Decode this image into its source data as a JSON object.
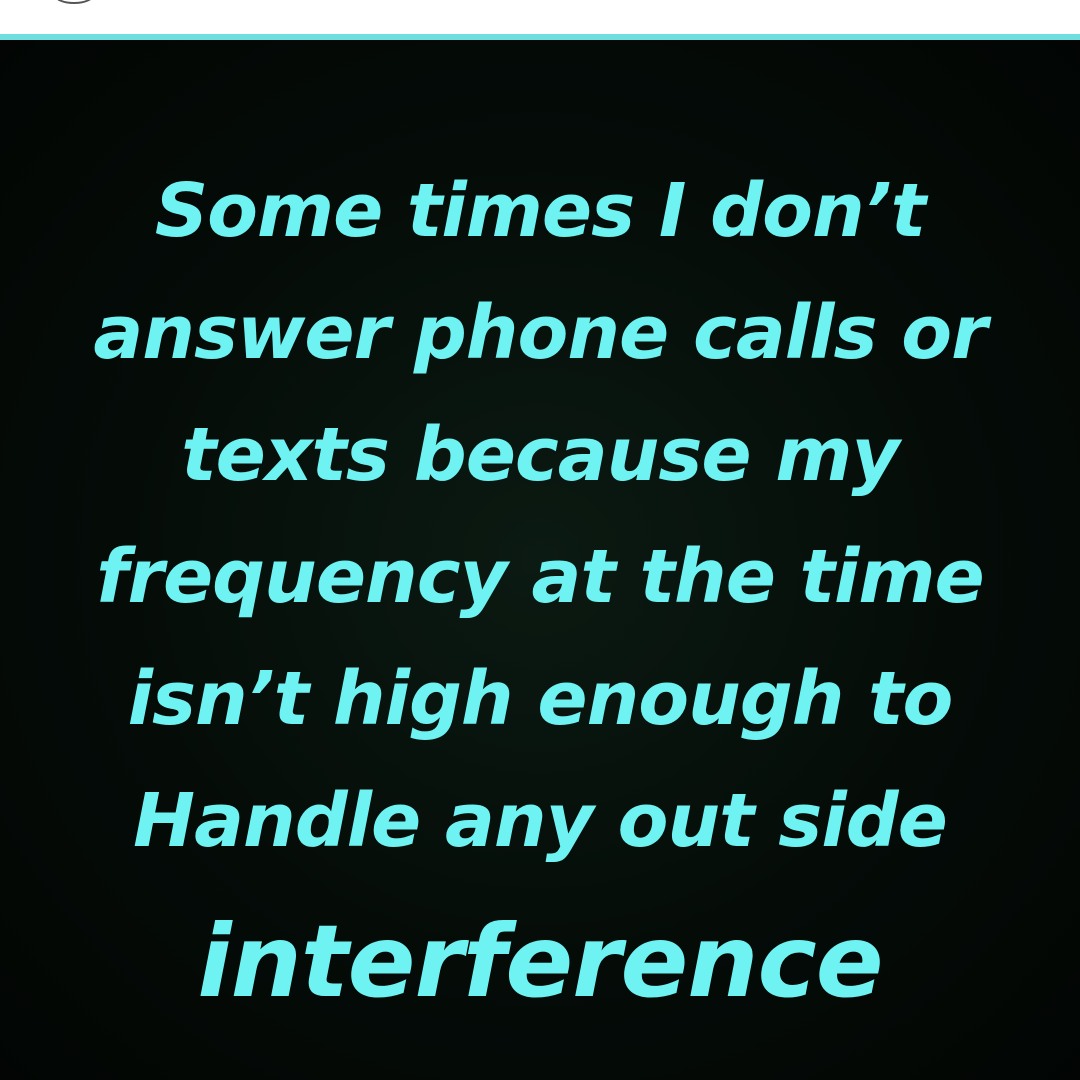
{
  "poster": {
    "background_color": "#050c08",
    "text_color": "#6ff2f2",
    "accent_rule_color": "#6fdede",
    "lines": [
      "Some times I don’t",
      "answer phone calls or",
      "texts because my",
      "frequency at the time",
      "isn’t high enough to",
      "Handle any out side",
      "interference"
    ]
  }
}
